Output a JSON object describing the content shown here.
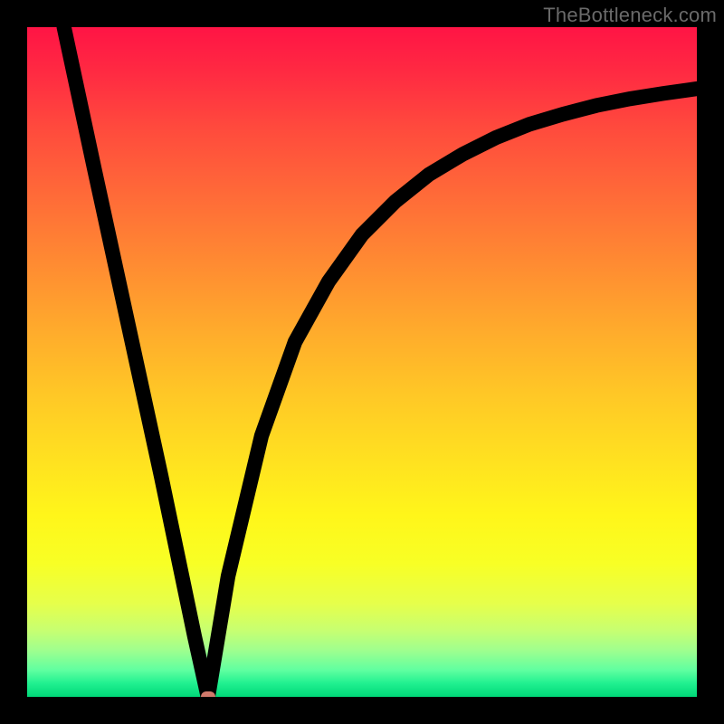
{
  "watermark": "TheBottleneck.com",
  "chart_data": {
    "type": "line",
    "title": "",
    "xlabel": "",
    "ylabel": "",
    "xlim": [
      0,
      100
    ],
    "ylim": [
      0,
      100
    ],
    "grid": false,
    "legend": false,
    "gradient_stops": [
      {
        "pos": 0,
        "color": "#ff1445"
      },
      {
        "pos": 25,
        "color": "#ff6a38"
      },
      {
        "pos": 50,
        "color": "#ffb828"
      },
      {
        "pos": 75,
        "color": "#fff61a"
      },
      {
        "pos": 90,
        "color": "#c8ff70"
      },
      {
        "pos": 100,
        "color": "#00d878"
      }
    ],
    "min_point": {
      "x": 27,
      "y": 0,
      "color": "#d07a6c"
    },
    "series": [
      {
        "name": "left-branch",
        "x": [
          5.5,
          10,
          15,
          20,
          25,
          27
        ],
        "y": [
          100,
          79,
          56,
          33,
          9,
          0
        ]
      },
      {
        "name": "right-branch",
        "x": [
          27,
          30,
          35,
          40,
          45,
          50,
          55,
          60,
          65,
          70,
          75,
          80,
          85,
          90,
          95,
          100
        ],
        "y": [
          0,
          18,
          39,
          53,
          62,
          69,
          74,
          78,
          81,
          83.5,
          85.5,
          87,
          88.3,
          89.3,
          90.1,
          90.8
        ]
      }
    ]
  }
}
